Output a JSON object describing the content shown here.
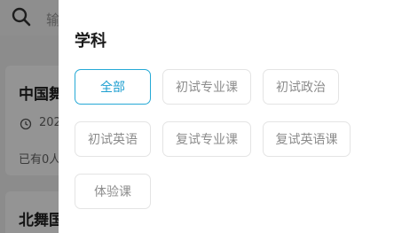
{
  "background": {
    "search_placeholder": "输",
    "cards": [
      {
        "title": "中国舞",
        "date": "202",
        "status": "已有0人"
      },
      {
        "title": "北舞国"
      }
    ]
  },
  "filter_panel": {
    "section_title": "学科",
    "options": [
      {
        "label": "全部",
        "selected": true
      },
      {
        "label": "初试专业课",
        "selected": false
      },
      {
        "label": "初试政治",
        "selected": false
      },
      {
        "label": "初试英语",
        "selected": false
      },
      {
        "label": "复试专业课",
        "selected": false
      },
      {
        "label": "复试英语课",
        "selected": false
      },
      {
        "label": "体验课",
        "selected": false
      }
    ]
  },
  "colors": {
    "accent": "#1d9fd0",
    "chip_border": "#e4e4e4",
    "chip_text": "#8c8c8c"
  }
}
